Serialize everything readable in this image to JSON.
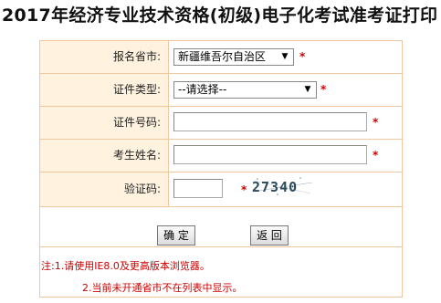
{
  "page_title": "2017年经济专业技术资格(初级)电子化考试准考证打印",
  "form": {
    "province": {
      "label": "报名省市:",
      "value": "新疆维吾尔自治区",
      "required": "*"
    },
    "cert_type": {
      "label": "证件类型:",
      "value": "--请选择--",
      "required": "*"
    },
    "cert_number": {
      "label": "证件号码:",
      "value": "",
      "required": "*"
    },
    "name": {
      "label": "考生姓名:",
      "value": "",
      "required": "*"
    },
    "captcha": {
      "label": "验证码:",
      "value": "",
      "required": "*",
      "image_text": "27340"
    }
  },
  "buttons": {
    "confirm": "确 定",
    "back": "返 回"
  },
  "notes": {
    "line1": "注:1.请使用IE8.0及更高版本浏览器。",
    "line2": "2.当前未开通省市不在列表中显示。"
  },
  "colors": {
    "required": "#d00000",
    "label_bg": "#fff3e0",
    "border": "#f0c8a0"
  }
}
